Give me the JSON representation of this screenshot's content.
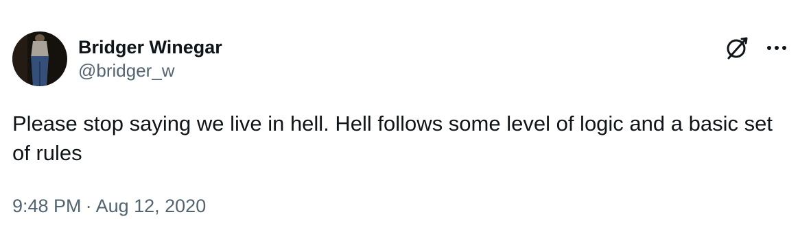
{
  "author": {
    "display_name": "Bridger Winegar",
    "handle": "@bridger_w"
  },
  "icons": {
    "grok": "grok-icon",
    "more": "more-options-icon"
  },
  "tweet": {
    "text": "Please stop saying we live in hell. Hell follows some level of logic and a basic set of rules"
  },
  "meta": {
    "time": "9:48 PM",
    "separator": "·",
    "date": "Aug 12, 2020"
  },
  "colors": {
    "text_primary": "#0f1419",
    "text_secondary": "#536471",
    "background": "#ffffff"
  }
}
